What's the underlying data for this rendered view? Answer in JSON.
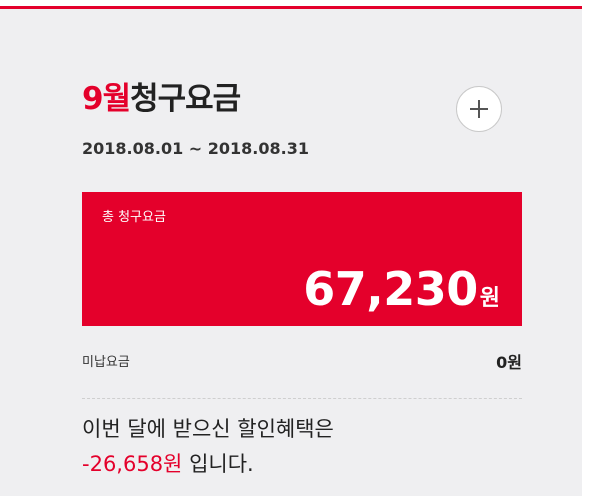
{
  "bill": {
    "month": "9월",
    "title_suffix": "청구요금",
    "period": "2018.08.01 ~ 2018.08.31",
    "expand_symbol": "+",
    "total": {
      "label": "총 청구요금",
      "amount": "67,230",
      "unit": "원"
    },
    "unpaid": {
      "label": "미납요금",
      "value": "0원"
    },
    "benefit": {
      "line1": "이번 달에 받으신 할인혜택은",
      "amount": "-26,658원",
      "suffix": " 입니다."
    }
  },
  "colors": {
    "accent": "#e4002b",
    "background": "#efeff1",
    "text": "#222222"
  }
}
